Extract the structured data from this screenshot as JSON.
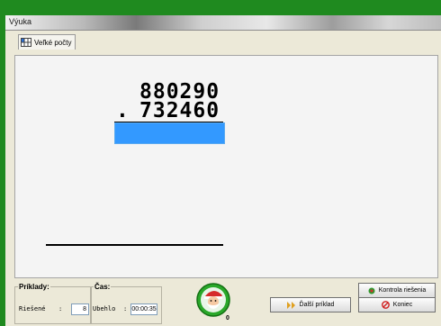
{
  "window": {
    "title": "Výuka"
  },
  "tabs": [
    {
      "label": "Veľké počty"
    }
  ],
  "problem": {
    "top_number": "880290",
    "operator": ".",
    "bottom_number": "732460",
    "answer": ""
  },
  "stats": {
    "group_label": "Príklady:",
    "solved_label": "Riešené",
    "solved_sep": ":",
    "solved_value": "8"
  },
  "time": {
    "group_label": "Čas:",
    "elapsed_label": "Ubehlo",
    "elapsed_sep": ":",
    "elapsed_value": "00:00:35"
  },
  "mascot": {
    "icon": "santa-icon",
    "counter": "0"
  },
  "buttons": {
    "check": "Kontrola riešenia",
    "next": "Ďalší príklad",
    "end": "Koniec"
  },
  "colors": {
    "accent": "#3399ff",
    "frame": "#1f8a1f"
  }
}
